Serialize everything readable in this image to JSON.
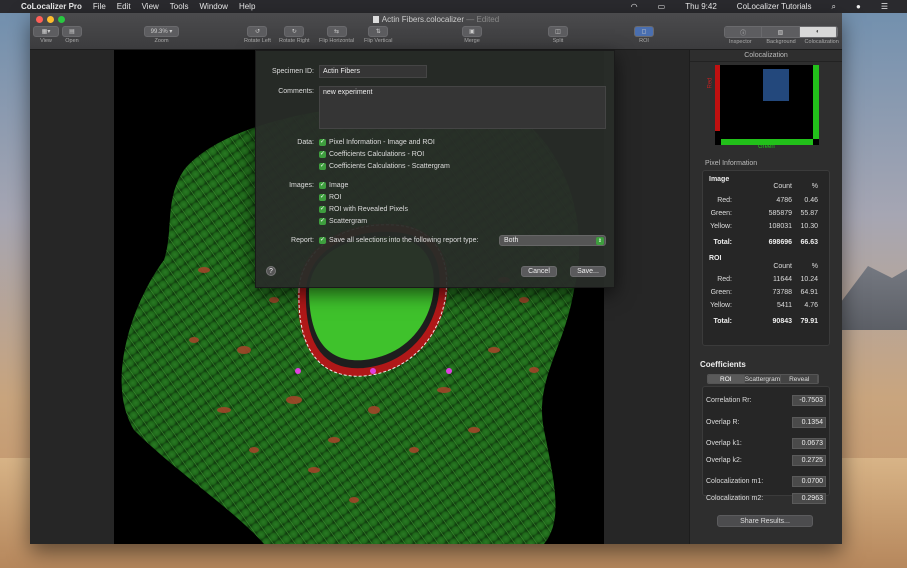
{
  "menubar": {
    "app": "CoLocalizer Pro",
    "items": [
      "File",
      "Edit",
      "View",
      "Tools",
      "Window",
      "Help"
    ],
    "clock": "Thu 9:42",
    "user": "CoLocalizer Tutorials"
  },
  "window": {
    "title": "Actin Fibers.colocalizer",
    "edited": "— Edited"
  },
  "toolbar": {
    "view": "View",
    "open": "Open",
    "zoom_value": "99.3%",
    "zoom": "Zoom",
    "rotate_left": "Rotate Left",
    "rotate_right": "Rotate Right",
    "flip_horizontal": "Flip Horizontal",
    "flip_vertical": "Flip Vertical",
    "merge": "Merge",
    "split": "Split",
    "roi": "ROI",
    "inspector": "Inspector",
    "background": "Background",
    "colocalization": "Colocalization"
  },
  "sidebar": {
    "title": "Colocalization",
    "axis_red": "Red",
    "axis_green": "Green",
    "pixel_info_label": "Pixel Information",
    "image": {
      "heading": "Image",
      "col_count": "Count",
      "col_pct": "%",
      "rows": [
        {
          "label": "Red:",
          "count": "4786",
          "pct": "0.46"
        },
        {
          "label": "Green:",
          "count": "585879",
          "pct": "55.87"
        },
        {
          "label": "Yellow:",
          "count": "108031",
          "pct": "10.30"
        },
        {
          "label": "Total:",
          "count": "698696",
          "pct": "66.63"
        }
      ]
    },
    "roi": {
      "heading": "ROI",
      "col_count": "Count",
      "col_pct": "%",
      "rows": [
        {
          "label": "Red:",
          "count": "11644",
          "pct": "10.24"
        },
        {
          "label": "Green:",
          "count": "73788",
          "pct": "64.91"
        },
        {
          "label": "Yellow:",
          "count": "5411",
          "pct": "4.76"
        },
        {
          "label": "Total:",
          "count": "90843",
          "pct": "79.91"
        }
      ]
    },
    "coefficients": {
      "heading": "Coefficients",
      "tabs": [
        "ROI",
        "Scattergram",
        "Reveal"
      ],
      "rows": [
        {
          "label": "Correlation Rr:",
          "value": "-0.7503"
        },
        {
          "label": "Overlap R:",
          "value": "0.1354"
        },
        {
          "label": "Overlap k1:",
          "value": "0.0673"
        },
        {
          "label": "Overlap k2:",
          "value": "0.2725"
        },
        {
          "label": "Colocalization m1:",
          "value": "0.0700"
        },
        {
          "label": "Colocalization m2:",
          "value": "0.2963"
        }
      ]
    },
    "share": "Share Results..."
  },
  "sheet": {
    "specimen_label": "Specimen ID:",
    "specimen_value": "Actin Fibers",
    "comments_label": "Comments:",
    "comments_value": "new experiment",
    "data_label": "Data:",
    "data_items": [
      "Pixel Information - Image and ROI",
      "Coefficients Calculations - ROI",
      "Coefficients Calculations - Scattergram"
    ],
    "images_label": "Images:",
    "image_items": [
      "Image",
      "ROI",
      "ROI with Revealed Pixels",
      "Scattergram"
    ],
    "report_label": "Report:",
    "report_text": "Save all selections into the following report type:",
    "report_type": "Both",
    "cancel": "Cancel",
    "save": "Save...",
    "help": "?"
  },
  "colors": {
    "close": "#ff5f57",
    "minimize": "#febc2e",
    "zoom": "#28c840",
    "check": "#3e9e3e"
  }
}
